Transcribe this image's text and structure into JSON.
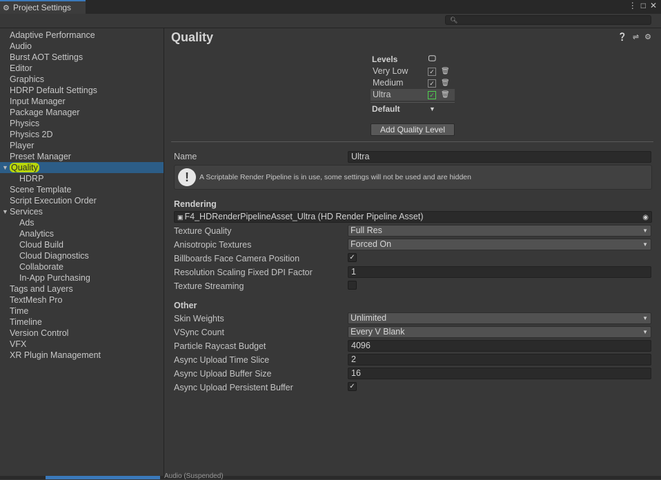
{
  "window": {
    "tab_title": "Project Settings",
    "controls": [
      "more-vertical-icon",
      "maximize-icon",
      "close-icon"
    ]
  },
  "search": {
    "placeholder": ""
  },
  "sidebar": {
    "items": [
      {
        "label": "Adaptive Performance",
        "level": 0
      },
      {
        "label": "Audio",
        "level": 0
      },
      {
        "label": "Burst AOT Settings",
        "level": 0
      },
      {
        "label": "Editor",
        "level": 0
      },
      {
        "label": "Graphics",
        "level": 0
      },
      {
        "label": "HDRP Default Settings",
        "level": 0
      },
      {
        "label": "Input Manager",
        "level": 0
      },
      {
        "label": "Package Manager",
        "level": 0
      },
      {
        "label": "Physics",
        "level": 0
      },
      {
        "label": "Physics 2D",
        "level": 0
      },
      {
        "label": "Player",
        "level": 0
      },
      {
        "label": "Preset Manager",
        "level": 0
      },
      {
        "label": "Quality",
        "level": 0,
        "selected": true,
        "expanded": true
      },
      {
        "label": "HDRP",
        "level": 1
      },
      {
        "label": "Scene Template",
        "level": 0
      },
      {
        "label": "Script Execution Order",
        "level": 0
      },
      {
        "label": "Services",
        "level": 0,
        "expanded": true
      },
      {
        "label": "Ads",
        "level": 1
      },
      {
        "label": "Analytics",
        "level": 1
      },
      {
        "label": "Cloud Build",
        "level": 1
      },
      {
        "label": "Cloud Diagnostics",
        "level": 1
      },
      {
        "label": "Collaborate",
        "level": 1
      },
      {
        "label": "In-App Purchasing",
        "level": 1
      },
      {
        "label": "Tags and Layers",
        "level": 0
      },
      {
        "label": "TextMesh Pro",
        "level": 0
      },
      {
        "label": "Time",
        "level": 0
      },
      {
        "label": "Timeline",
        "level": 0
      },
      {
        "label": "Version Control",
        "level": 0
      },
      {
        "label": "VFX",
        "level": 0
      },
      {
        "label": "XR Plugin Management",
        "level": 0
      }
    ]
  },
  "main": {
    "title": "Quality",
    "header_icons": [
      "help-icon",
      "presets-icon",
      "settings-icon"
    ],
    "levels": {
      "header": "Levels",
      "rows": [
        {
          "name": "Very Low",
          "checked": true
        },
        {
          "name": "Medium",
          "checked": true
        },
        {
          "name": "Ultra",
          "checked": true,
          "selected": true
        }
      ],
      "default_label": "Default",
      "add_button": "Add Quality Level"
    },
    "name_label": "Name",
    "name_value": "Ultra",
    "warning": "A Scriptable Render Pipeline is in use, some settings will not be used and are hidden",
    "rendering": {
      "section": "Rendering",
      "pipeline_asset": "F4_HDRenderPipelineAsset_Ultra (HD Render Pipeline Asset)",
      "texture_quality_label": "Texture Quality",
      "texture_quality": "Full Res",
      "aniso_label": "Anisotropic Textures",
      "aniso": "Forced On",
      "billboards_label": "Billboards Face Camera Position",
      "billboards": true,
      "dpi_label": "Resolution Scaling Fixed DPI Factor",
      "dpi": "1",
      "streaming_label": "Texture Streaming",
      "streaming": false
    },
    "other": {
      "section": "Other",
      "skin_weights_label": "Skin Weights",
      "skin_weights": "Unlimited",
      "vsync_label": "VSync Count",
      "vsync": "Every V Blank",
      "raycast_label": "Particle Raycast Budget",
      "raycast": "4096",
      "upload_slice_label": "Async Upload Time Slice",
      "upload_slice": "2",
      "upload_buffer_label": "Async Upload Buffer Size",
      "upload_buffer": "16",
      "persistent_label": "Async Upload Persistent Buffer",
      "persistent": true
    }
  },
  "bottom": {
    "text": "Audio (Suspended)"
  }
}
